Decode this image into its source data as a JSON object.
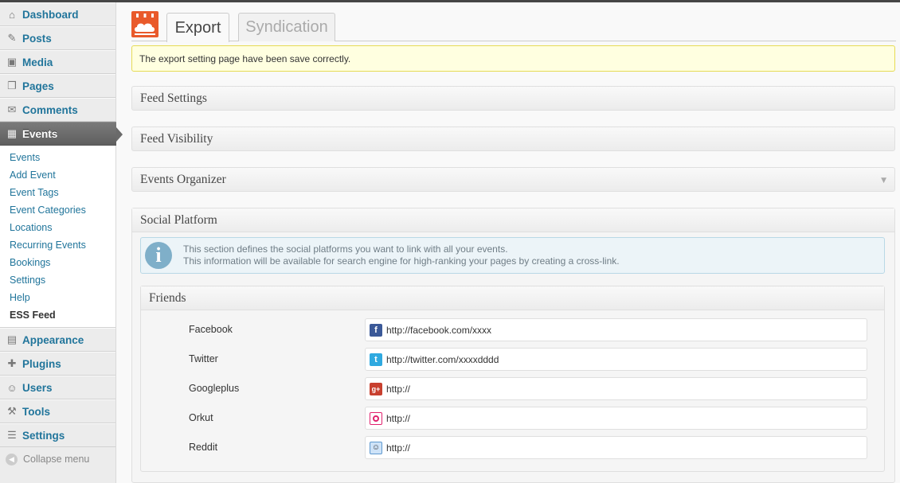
{
  "sidebar": {
    "top_items": [
      {
        "label": "Dashboard",
        "icon": "dashboard-icon"
      },
      {
        "label": "Posts",
        "icon": "pin-icon"
      },
      {
        "label": "Media",
        "icon": "media-icon"
      },
      {
        "label": "Pages",
        "icon": "pages-icon"
      },
      {
        "label": "Comments",
        "icon": "comment-icon"
      }
    ],
    "active_item": {
      "label": "Events",
      "icon": "calendar-icon"
    },
    "submenu": [
      "Events",
      "Add Event",
      "Event Tags",
      "Event Categories",
      "Locations",
      "Recurring Events",
      "Bookings",
      "Settings",
      "Help",
      "ESS Feed"
    ],
    "bottom_items": [
      {
        "label": "Appearance",
        "icon": "appearance-icon"
      },
      {
        "label": "Plugins",
        "icon": "plugin-icon"
      },
      {
        "label": "Users",
        "icon": "users-icon"
      },
      {
        "label": "Tools",
        "icon": "tools-icon"
      },
      {
        "label": "Settings",
        "icon": "settings-icon"
      }
    ],
    "collapse_label": "Collapse menu"
  },
  "tabs": {
    "export": "Export",
    "syndication": "Syndication"
  },
  "notice": "The export setting page have been save correctly.",
  "panels": {
    "feed_settings": "Feed Settings",
    "feed_visibility": "Feed Visibility",
    "events_organizer": "Events Organizer",
    "social_platform": "Social Platform"
  },
  "info": {
    "line1": "This section defines the social platforms you want to link with all your events.",
    "line2": "This information will be available for search engine for high-ranking your pages by creating a cross-link."
  },
  "friends": {
    "title": "Friends",
    "rows": [
      {
        "label": "Facebook",
        "value": "http://facebook.com/xxxx",
        "icon": "facebook-icon",
        "color": "#3b5998"
      },
      {
        "label": "Twitter",
        "value": "http://twitter.com/xxxxdddd",
        "icon": "twitter-icon",
        "color": "#2fa9e0"
      },
      {
        "label": "Googleplus",
        "value": "http://",
        "icon": "googleplus-icon",
        "color": "#c8402f"
      },
      {
        "label": "Orkut",
        "value": "http://",
        "icon": "orkut-icon",
        "color": "#e0226e"
      },
      {
        "label": "Reddit",
        "value": "http://",
        "icon": "reddit-icon",
        "color": "#5f99cf"
      }
    ]
  },
  "colors": {
    "accent": "#21759b",
    "brand": "#e95a2b",
    "notice_bg": "#ffffe0"
  }
}
